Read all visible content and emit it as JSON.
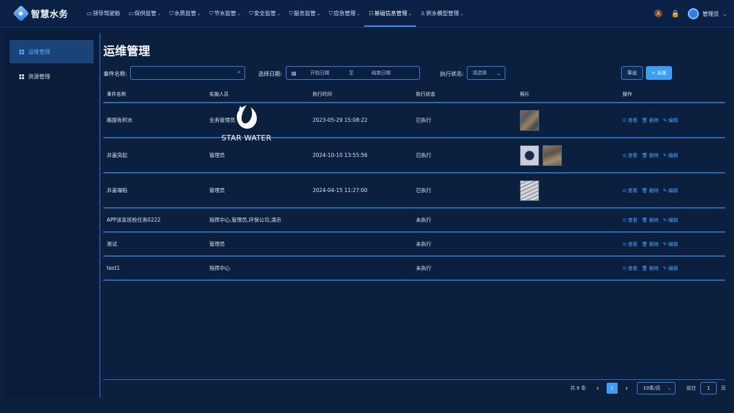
{
  "app": {
    "title": "智慧水务",
    "logo_glyph": "◆"
  },
  "nav": [
    {
      "icon": "monitor-icon",
      "glyph": "▭",
      "label": "领导驾驶舱",
      "has_menu": false
    },
    {
      "icon": "monitor-icon",
      "glyph": "▭",
      "label": "保供监管",
      "has_menu": true
    },
    {
      "icon": "shield-icon",
      "glyph": "⛉",
      "label": "水质监管",
      "has_menu": true
    },
    {
      "icon": "shield-icon",
      "glyph": "⛉",
      "label": "节水监管",
      "has_menu": true
    },
    {
      "icon": "shield-icon",
      "glyph": "⛉",
      "label": "安全监管",
      "has_menu": true
    },
    {
      "icon": "shield-icon",
      "glyph": "⛉",
      "label": "服务监管",
      "has_menu": true
    },
    {
      "icon": "shield-icon",
      "glyph": "⛉",
      "label": "应急管理",
      "has_menu": true
    },
    {
      "icon": "database-icon",
      "glyph": "☷",
      "label": "基础信息管理",
      "has_menu": true,
      "active": true
    },
    {
      "icon": "hierarchy-icon",
      "glyph": "♙",
      "label": "供水模型管理",
      "has_menu": true
    }
  ],
  "header_right": {
    "user_name": "管理员",
    "bell_glyph": "🔕",
    "lock_glyph": "🔒"
  },
  "sidebar": [
    {
      "label": "运维管理",
      "active": true
    },
    {
      "label": "资源管理",
      "active": false
    }
  ],
  "page": {
    "title": "运维管理"
  },
  "filters": {
    "event_name_label": "事件名称:",
    "event_name_value": "",
    "date_label": "选择日期:",
    "date_start_placeholder": "开始日期",
    "date_separator": "至",
    "date_end_placeholder": "结束日期",
    "status_label": "执行状态:",
    "status_value": "请选择",
    "export_label": "导出",
    "add_label": "+ 派发"
  },
  "table": {
    "headers": [
      "事件名称",
      "实施人员",
      "执行时间",
      "执行状态",
      "照片",
      "操作"
    ],
    "rows": [
      {
        "name": "路面有积水",
        "staff": "业务管理员",
        "time": "2023-05-29 15:08:22",
        "status": "已执行",
        "photos": [
          "t1"
        ]
      },
      {
        "name": "井盖突起",
        "staff": "管理员",
        "time": "2024-10-10 13:55:56",
        "status": "已执行",
        "photos": [
          "t2",
          "t3"
        ]
      },
      {
        "name": "井盖塌陷",
        "staff": "管理员",
        "time": "2024-04-15 11:27:00",
        "status": "已执行",
        "photos": [
          "t4"
        ]
      },
      {
        "name": "APP派发巡检任务0222",
        "staff": "指挥中心,管理员,环保公司,演示",
        "time": "",
        "status": "未执行",
        "photos": []
      },
      {
        "name": "测试",
        "staff": "管理员",
        "time": "",
        "status": "未执行",
        "photos": []
      },
      {
        "name": "test1",
        "staff": "指挥中心",
        "time": "",
        "status": "未执行",
        "photos": []
      }
    ],
    "actions": {
      "view": "查看",
      "delete": "删除",
      "edit": "编辑"
    }
  },
  "watermark": {
    "text": "STAR WATER"
  },
  "pagination": {
    "total": "共 6 条",
    "current_page": "1",
    "page_size": "10条/页",
    "goto_label": "前往",
    "goto_value": "1",
    "page_unit": "页"
  },
  "colors": {
    "accent": "#3d9df3",
    "background": "#0b1f3f",
    "link": "#4aa0ff"
  }
}
